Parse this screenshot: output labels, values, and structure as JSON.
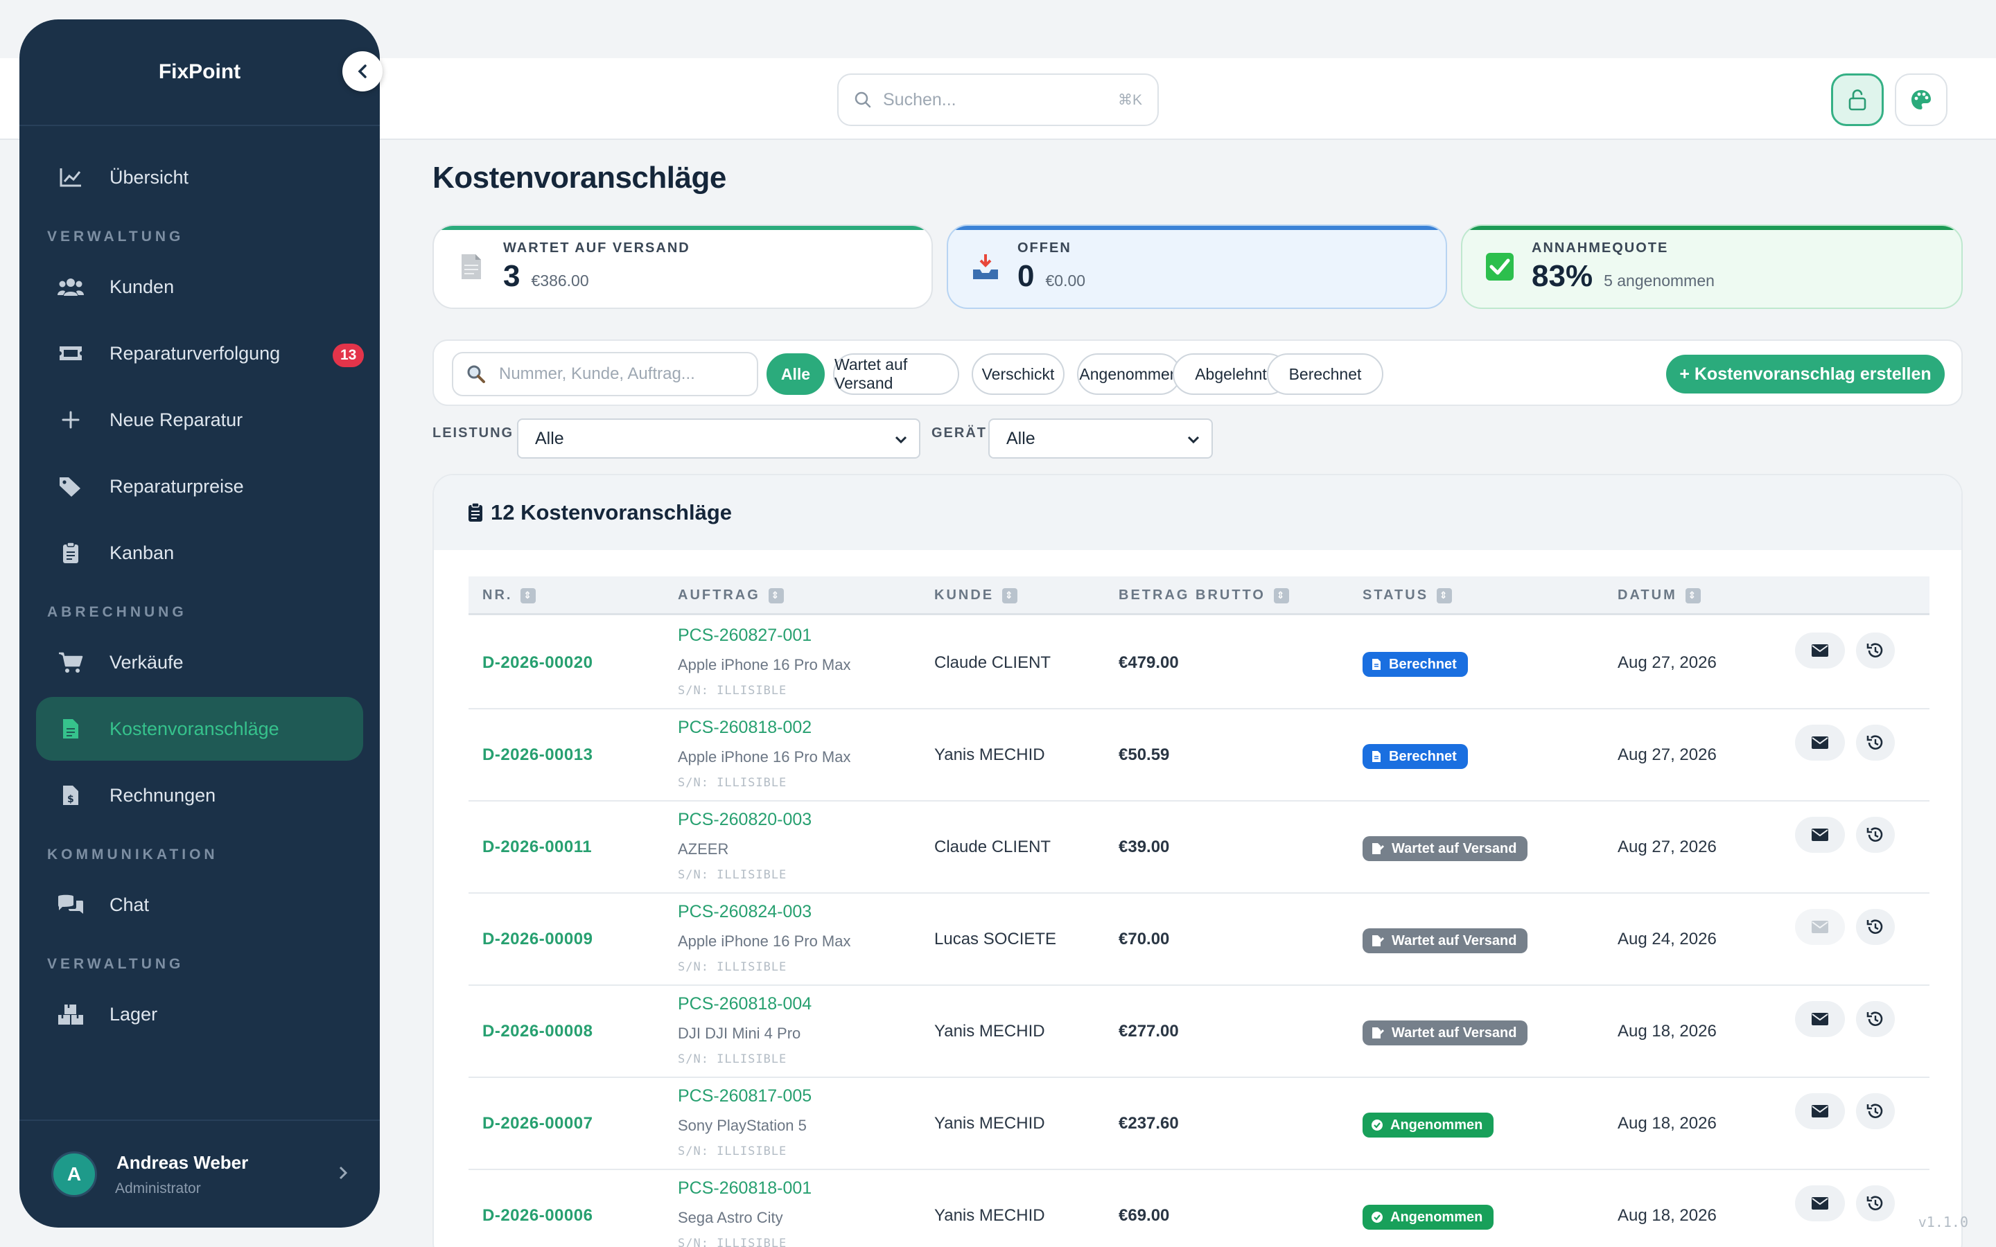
{
  "app": {
    "name": "FixPoint",
    "version": "v1.1.0"
  },
  "sidebar": {
    "items": [
      {
        "label": "Übersicht",
        "icon": "chart-line-icon"
      },
      {
        "section": "VERWALTUNG"
      },
      {
        "label": "Kunden",
        "icon": "users-icon"
      },
      {
        "label": "Reparaturverfolgung",
        "icon": "ticket-icon",
        "badge": "13"
      },
      {
        "label": "Neue Reparatur",
        "icon": "plus-icon"
      },
      {
        "label": "Reparaturpreise",
        "icon": "tags-icon"
      },
      {
        "label": "Kanban",
        "icon": "clipboard-icon"
      },
      {
        "section": "ABRECHNUNG"
      },
      {
        "label": "Verkäufe",
        "icon": "cart-icon"
      },
      {
        "label": "Kostenvoranschläge",
        "icon": "file-icon",
        "active": true
      },
      {
        "label": "Rechnungen",
        "icon": "invoice-icon"
      },
      {
        "section": "KOMMUNIKATION"
      },
      {
        "label": "Chat",
        "icon": "comments-icon"
      },
      {
        "section": "VERWALTUNG"
      },
      {
        "label": "Lager",
        "icon": "boxes-icon"
      }
    ],
    "user": {
      "initial": "A",
      "name": "Andreas Weber",
      "role": "Administrator"
    }
  },
  "topbar": {
    "search_placeholder": "Suchen...",
    "search_shortcut": "⌘K"
  },
  "page": {
    "title": "Kostenvoranschläge"
  },
  "stats": [
    {
      "label": "WARTET AUF VERSAND",
      "value": "3",
      "sub": "€386.00",
      "color": "#2bab7c"
    },
    {
      "label": "OFFEN",
      "value": "0",
      "sub": "€0.00",
      "color": "#3b82d6"
    },
    {
      "label": "ANNAHMEQUOTE",
      "value": "83%",
      "sub": "5 angenommen",
      "color": "#1c9a55"
    }
  ],
  "filters": {
    "search_placeholder": "Nummer, Kunde, Auftrag...",
    "chips": [
      "Alle",
      "Wartet auf Versand",
      "Verschickt",
      "Angenommen",
      "Abgelehnt",
      "Berechnet"
    ],
    "active_chip": "Alle",
    "create_label": "+ Kostenvoranschlag erstellen",
    "leistung_label": "LEISTUNG",
    "leistung_value": "Alle",
    "geraet_label": "GERÄT",
    "geraet_value": "Alle"
  },
  "table": {
    "title": "12 Kostenvoranschläge",
    "columns": [
      "NR.",
      "AUFTRAG",
      "KUNDE",
      "BETRAG BRUTTO",
      "STATUS",
      "DATUM"
    ],
    "rows": [
      {
        "nr": "D-2026-00020",
        "auftrag": "PCS-260827-001",
        "geraet": "Apple iPhone 16 Pro Max",
        "sn": "S/N: ILLISIBLE",
        "kunde": "Claude CLIENT",
        "betrag": "€479.00",
        "status": "Berechnet",
        "datum": "Aug 27, 2026",
        "mail_enabled": true
      },
      {
        "nr": "D-2026-00013",
        "auftrag": "PCS-260818-002",
        "geraet": "Apple iPhone 16 Pro Max",
        "sn": "S/N: ILLISIBLE",
        "kunde": "Yanis MECHID",
        "betrag": "€50.59",
        "status": "Berechnet",
        "datum": "Aug 27, 2026",
        "mail_enabled": true
      },
      {
        "nr": "D-2026-00011",
        "auftrag": "PCS-260820-003",
        "geraet": "AZEER",
        "sn": "S/N: ILLISIBLE",
        "kunde": "Claude CLIENT",
        "betrag": "€39.00",
        "status": "Wartet auf Versand",
        "datum": "Aug 27, 2026",
        "mail_enabled": true
      },
      {
        "nr": "D-2026-00009",
        "auftrag": "PCS-260824-003",
        "geraet": "Apple iPhone 16 Pro Max",
        "sn": "S/N: ILLISIBLE",
        "kunde": "Lucas SOCIETE",
        "betrag": "€70.00",
        "status": "Wartet auf Versand",
        "datum": "Aug 24, 2026",
        "mail_enabled": false
      },
      {
        "nr": "D-2026-00008",
        "auftrag": "PCS-260818-004",
        "geraet": "DJI DJI Mini 4 Pro",
        "sn": "S/N: ILLISIBLE",
        "kunde": "Yanis MECHID",
        "betrag": "€277.00",
        "status": "Wartet auf Versand",
        "datum": "Aug 18, 2026",
        "mail_enabled": true
      },
      {
        "nr": "D-2026-00007",
        "auftrag": "PCS-260817-005",
        "geraet": "Sony PlayStation 5",
        "sn": "S/N: ILLISIBLE",
        "kunde": "Yanis MECHID",
        "betrag": "€237.60",
        "status": "Angenommen",
        "datum": "Aug 18, 2026",
        "mail_enabled": true
      },
      {
        "nr": "D-2026-00006",
        "auftrag": "PCS-260818-001",
        "geraet": "Sega Astro City",
        "sn": "S/N: ILLISIBLE",
        "kunde": "Yanis MECHID",
        "betrag": "€69.00",
        "status": "Angenommen",
        "datum": "Aug 18, 2026",
        "mail_enabled": true
      }
    ]
  }
}
